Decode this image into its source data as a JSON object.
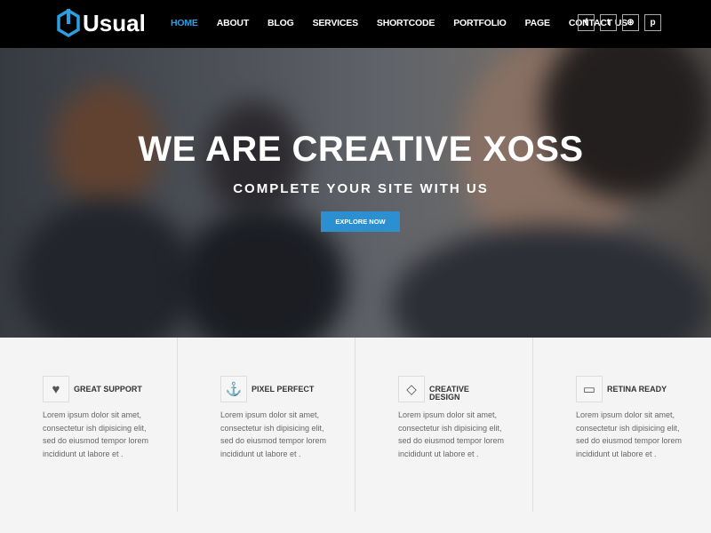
{
  "brand": {
    "name": "Usual",
    "accent": "#2b9fe0"
  },
  "nav": {
    "items": [
      {
        "label": "HOME",
        "active": true
      },
      {
        "label": "ABOUT"
      },
      {
        "label": "BLOG"
      },
      {
        "label": "SERVICES"
      },
      {
        "label": "SHORTCODE"
      },
      {
        "label": "PORTFOLIO"
      },
      {
        "label": "PAGE"
      },
      {
        "label": "CONTACT US"
      }
    ],
    "social": [
      {
        "icon": "facebook-icon",
        "glyph": "f"
      },
      {
        "icon": "twitter-icon",
        "glyph": "t"
      },
      {
        "icon": "dribbble-icon",
        "glyph": "⊛"
      },
      {
        "icon": "pinterest-icon",
        "glyph": "p"
      }
    ]
  },
  "hero": {
    "title": "WE ARE CREATIVE XOSS",
    "subtitle": "COMPLETE YOUR SITE WITH US",
    "button": "EXPLORE NOW"
  },
  "features": [
    {
      "icon": "heart-icon",
      "glyph": "♥",
      "title": "GREAT SUPPORT",
      "text": "Lorem ipsum dolor sit amet, consectetur ish dipisicing elit, sed do eiusmod tempor lorem incididunt ut labore et ."
    },
    {
      "icon": "anchor-icon",
      "glyph": "⚓",
      "title": "PIXEL PERFECT",
      "text": "Lorem ipsum dolor sit amet, consectetur ish dipisicing elit, sed do eiusmod tempor lorem incididunt ut labore et ."
    },
    {
      "icon": "diamond-icon",
      "glyph": "◇",
      "title": "CREATIVE DESIGN",
      "text": "Lorem ipsum dolor sit amet, consectetur ish dipisicing elit, sed do eiusmod tempor lorem incididunt ut labore et ."
    },
    {
      "icon": "monitor-icon",
      "glyph": "▭",
      "title": "RETINA READY",
      "text": "Lorem ipsum dolor sit amet, consectetur ish dipisicing elit, sed do eiusmod tempor lorem incididunt ut labore et ."
    }
  ]
}
